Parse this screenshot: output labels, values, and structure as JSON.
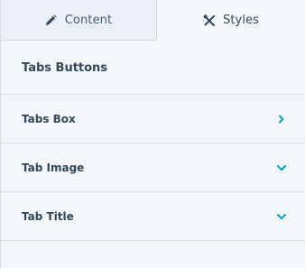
{
  "tabs": {
    "content_label": "Content",
    "styles_label": "Styles"
  },
  "section": {
    "title": "Tabs Buttons"
  },
  "rows": [
    {
      "label": "Tabs Box",
      "chevron": "chevron-right-icon"
    },
    {
      "label": "Tab Image",
      "chevron": "chevron-down-icon"
    },
    {
      "label": "Tab Title",
      "chevron": "chevron-down-icon"
    }
  ],
  "colors": {
    "accent": "#00a4bd",
    "text": "#33475b",
    "panel_bg": "#f4f7fa",
    "inactive_tab_bg": "#eaf0f6",
    "divider": "#d6dfe8"
  }
}
